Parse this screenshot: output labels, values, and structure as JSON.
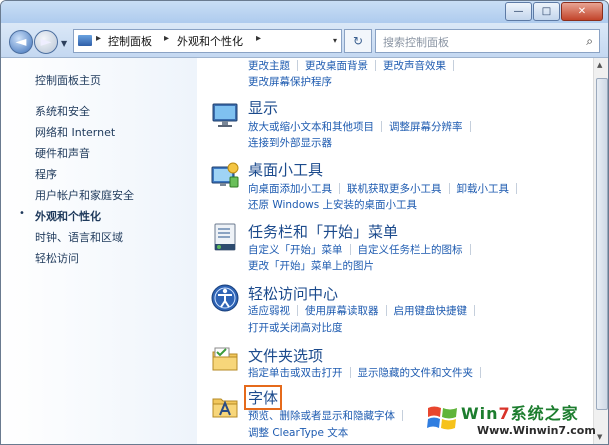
{
  "titlebar": {
    "min": "—",
    "max": "□",
    "close": "✕"
  },
  "nav": {
    "back": "◄",
    "forward": "►",
    "dropdown": "▼"
  },
  "address": {
    "crumbs": [
      "控制面板",
      "外观和个性化"
    ],
    "sep": "▸",
    "dd": "▾"
  },
  "refresh": "↻",
  "search": {
    "placeholder": "搜索控制面板",
    "icon": "⌕"
  },
  "sidebar": {
    "items": [
      {
        "label": "控制面板主页"
      },
      {
        "label": "系统和安全"
      },
      {
        "label": "网络和 Internet"
      },
      {
        "label": "硬件和声音"
      },
      {
        "label": "程序"
      },
      {
        "label": "用户帐户和家庭安全"
      },
      {
        "label": "外观和个性化",
        "active": true
      },
      {
        "label": "时钟、语言和区域"
      },
      {
        "label": "轻松访问"
      }
    ],
    "bullet": "•"
  },
  "main": {
    "top_links": [
      [
        "更改主题",
        "更改桌面背景",
        "更改声音效果"
      ],
      [
        "更改屏幕保护程序"
      ]
    ],
    "categories": [
      {
        "title": "显示",
        "icon": "display-icon",
        "links": [
          [
            "放大或缩小文本和其他项目",
            "调整屏幕分辨率"
          ],
          [
            "连接到外部显示器"
          ]
        ]
      },
      {
        "title": "桌面小工具",
        "icon": "gadgets-icon",
        "links": [
          [
            "向桌面添加小工具",
            "联机获取更多小工具",
            "卸载小工具"
          ],
          [
            "还原 Windows 上安装的桌面小工具"
          ]
        ]
      },
      {
        "title": "任务栏和「开始」菜单",
        "icon": "taskbar-icon",
        "links": [
          [
            "自定义「开始」菜单",
            "自定义任务栏上的图标"
          ],
          [
            "更改「开始」菜单上的图片"
          ]
        ]
      },
      {
        "title": "轻松访问中心",
        "icon": "ease-of-access-icon",
        "links": [
          [
            "适应弱视",
            "使用屏幕读取器",
            "启用键盘快捷键"
          ],
          [
            "打开或关闭高对比度"
          ]
        ]
      },
      {
        "title": "文件夹选项",
        "icon": "folder-options-icon",
        "links": [
          [
            "指定单击或双击打开",
            "显示隐藏的文件和文件夹"
          ]
        ]
      },
      {
        "title": "字体",
        "icon": "fonts-icon",
        "highlighted": true,
        "links": [
          [
            "预览、删除或者显示和隐藏字体"
          ],
          [
            "调整 ClearType 文本"
          ]
        ]
      }
    ]
  },
  "watermark": {
    "brand_a": "Win",
    "brand_b": "7",
    "brand_c": "系统之家",
    "url": "Www.Winwin7.com"
  },
  "colors": {
    "link": "#1e5bb0",
    "title": "#1b4a8c",
    "highlight": "#e56a1b"
  }
}
